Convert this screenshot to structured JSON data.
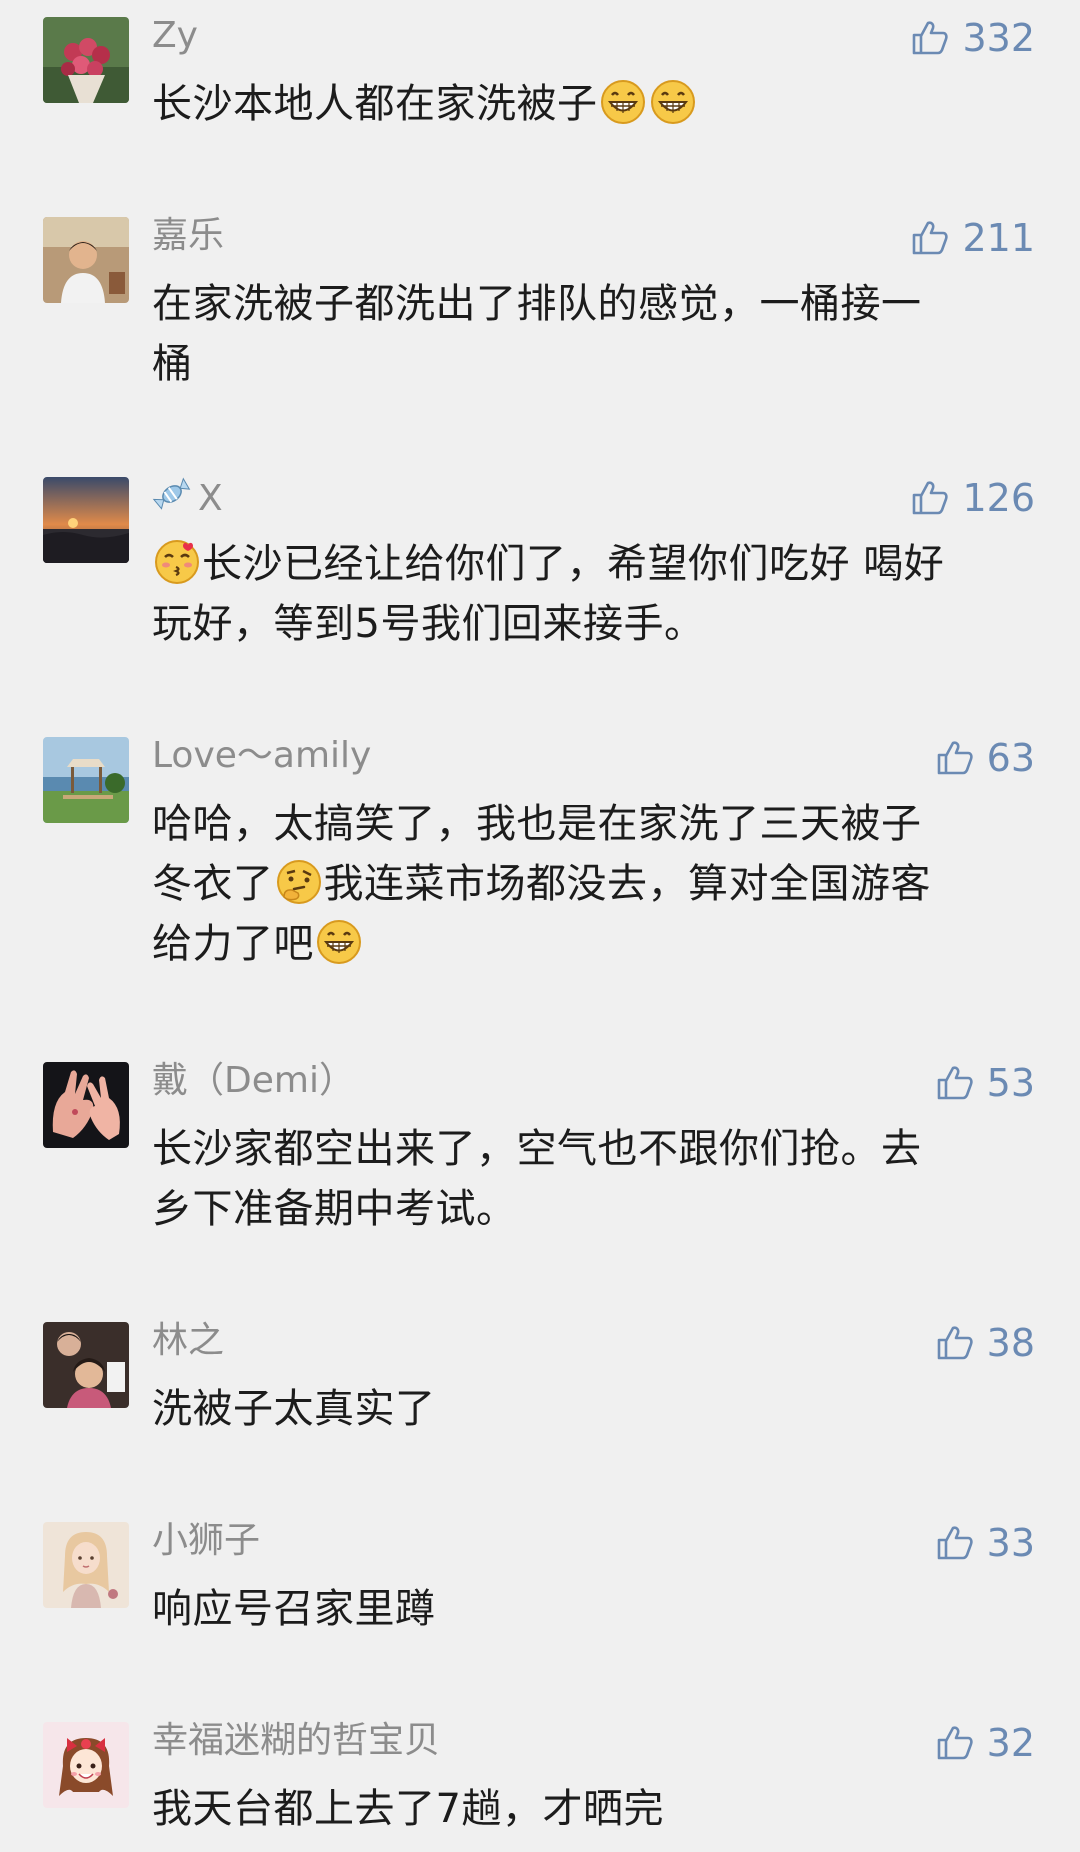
{
  "colors": {
    "background": "#f0f0f0",
    "username": "#8c8c8c",
    "like": "#6b8ab3",
    "text": "#1c1c1c"
  },
  "comments": [
    {
      "username": "Zy",
      "likes": "332",
      "avatar": "flower-bouquet-avatar",
      "lines": [
        {
          "text": "长沙本地人都在家洗被子",
          "emojis_after": [
            "grin-emoji",
            "grin-emoji"
          ]
        }
      ]
    },
    {
      "username": "嘉乐",
      "likes": "211",
      "avatar": "person-photo-avatar",
      "lines": [
        {
          "text": "在家洗被子都洗出了排队的感觉，一桶接一"
        },
        {
          "text": "桶"
        }
      ]
    },
    {
      "username": "X",
      "username_icon": "candy-icon",
      "likes": "126",
      "avatar": "sunset-lake-avatar",
      "lines": [
        {
          "emojis_before": [
            "kiss-emoji"
          ],
          "text": "长沙已经让给你们了，希望你们吃好 喝好"
        },
        {
          "text": "玩好，等到5号我们回来接手。"
        }
      ]
    },
    {
      "username": "Love～amily",
      "likes": "63",
      "avatar": "beach-hut-avatar",
      "lines": [
        {
          "text": "哈哈，太搞笑了，我也是在家洗了三天被子"
        },
        {
          "text_a": "冬衣了",
          "emoji_mid": "thinking-emoji",
          "text_b": "我连菜市场都没去，算对全国游客"
        },
        {
          "text": "给力了吧",
          "emojis_after": [
            "grin-emoji"
          ]
        }
      ]
    },
    {
      "username": "戴（Demi）",
      "likes": "53",
      "avatar": "hands-avatar",
      "lines": [
        {
          "text": "长沙家都空出来了，空气也不跟你们抢。去"
        },
        {
          "text": "乡下准备期中考试。"
        }
      ]
    },
    {
      "username": "林之",
      "likes": "38",
      "avatar": "family-photo-avatar",
      "lines": [
        {
          "text": "洗被子太真实了"
        }
      ]
    },
    {
      "username": "小狮子",
      "likes": "33",
      "avatar": "illustrated-girl-avatar",
      "lines": [
        {
          "text": "响应号召家里蹲"
        }
      ]
    },
    {
      "username": "幸福迷糊的哲宝贝",
      "likes": "32",
      "avatar": "cartoon-girl-avatar",
      "lines": [
        {
          "text": "我天台都上去了7趟，才晒完"
        }
      ]
    }
  ]
}
